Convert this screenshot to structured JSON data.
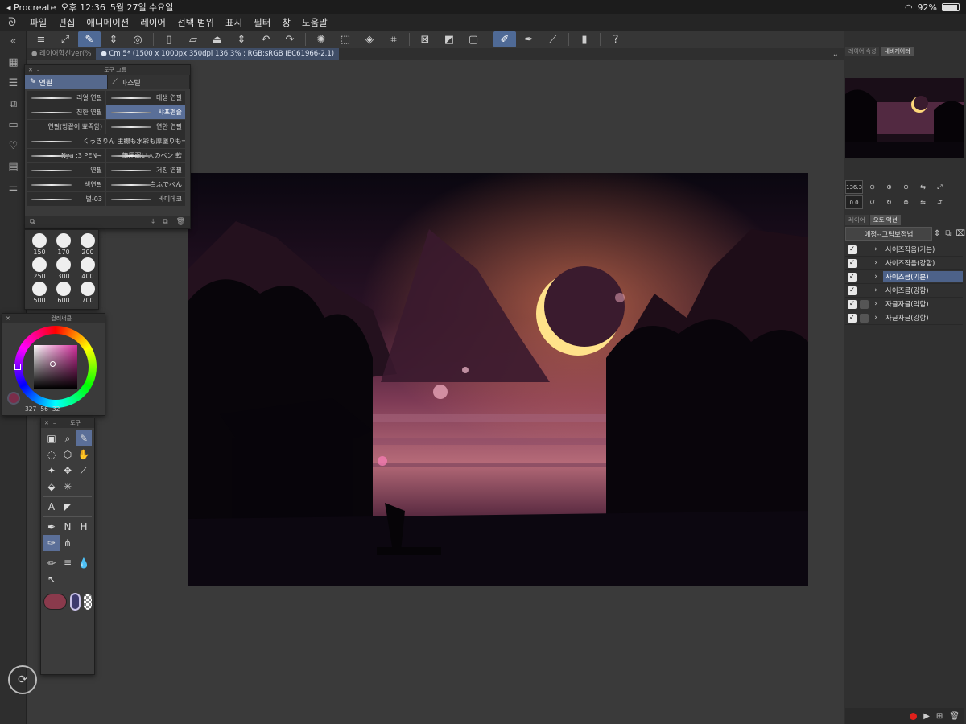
{
  "status_bar": {
    "back_app": "◂ Procreate",
    "time": "오후 12:36",
    "date": "5월 27일 수요일",
    "battery": "92%"
  },
  "menu": [
    "파일",
    "편집",
    "애니메이션",
    "레이어",
    "선택 범위",
    "표시",
    "필터",
    "창",
    "도움말"
  ],
  "document_tabs": [
    {
      "label": "● 레이어합친ver(%",
      "active": false
    },
    {
      "label": "● Cm 5* (1500 x 1000px 350dpi 136.3% : RGB:sRGB IEC61966-2.1)",
      "active": true
    }
  ],
  "brush_panel": {
    "title": "도구 그룹",
    "tabs": [
      {
        "label": "연필",
        "active": true
      },
      {
        "label": "파스텔",
        "active": false
      }
    ],
    "brushes": [
      {
        "label": "리얼 연필",
        "active": false
      },
      {
        "label": "데생 연필",
        "active": false
      },
      {
        "label": "진한 연필",
        "active": false
      },
      {
        "label": "샤프펜슬",
        "active": true
      },
      {
        "label": "연필(방끝이 뾰족함)",
        "active": false
      },
      {
        "label": "연한 연필",
        "active": false
      },
      {
        "label": "くっきりん 主線も水彩も厚塗りも一本で",
        "active": false
      },
      {
        "label": "",
        "active": false
      },
      {
        "label": "Nya :3 PEN~",
        "active": false
      },
      {
        "label": "筆圧弱い人のペン 軟",
        "active": false
      },
      {
        "label": "연필",
        "active": false
      },
      {
        "label": "거친 연필",
        "active": false
      },
      {
        "label": "색연필",
        "active": false
      },
      {
        "label": "白ふでぺん",
        "active": false
      },
      {
        "label": "별-03",
        "active": false
      },
      {
        "label": "바디데코",
        "active": false
      }
    ]
  },
  "brush_sizes": [
    "150",
    "170",
    "200",
    "250",
    "300",
    "400",
    "500",
    "600",
    "700"
  ],
  "color_panel": {
    "title": "컬러써클",
    "h": "327",
    "s": "56",
    "v": "32",
    "main_color": "#8a3a4c",
    "sub_color": "#3d3a6e"
  },
  "tool_panel": {
    "title": "도구"
  },
  "right_panel": {
    "top_tabs": [
      {
        "label": "레이어 속성",
        "active": false
      },
      {
        "label": "내비게이터",
        "active": true
      }
    ],
    "zoom": "136.3",
    "angle": "0.0",
    "action_tabs": [
      {
        "label": "레이어",
        "active": false
      },
      {
        "label": "오토 액션",
        "active": true
      }
    ],
    "action_set": "애정--그림보정법",
    "actions": [
      {
        "label": "사이즈작음(기본)",
        "checked": true,
        "sub": false,
        "active": false
      },
      {
        "label": "사이즈작음(강함)",
        "checked": true,
        "sub": false,
        "active": false
      },
      {
        "label": "사이즈큼(기본)",
        "checked": true,
        "sub": false,
        "active": true
      },
      {
        "label": "사이즈큼(강함)",
        "checked": true,
        "sub": false,
        "active": false
      },
      {
        "label": "자글자글(약함)",
        "checked": true,
        "sub": true,
        "active": false
      },
      {
        "label": "자글자글(강함)",
        "checked": true,
        "sub": true,
        "active": false
      }
    ]
  },
  "colors": {
    "accent": "#4f6a96",
    "record": "#e0201b"
  }
}
